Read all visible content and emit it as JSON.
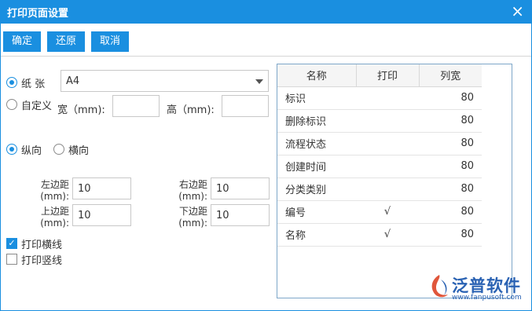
{
  "window": {
    "title": "打印页面设置",
    "close_icon": "close-icon"
  },
  "toolbar": {
    "confirm_label": "确定",
    "restore_label": "还原",
    "cancel_label": "取消"
  },
  "paper": {
    "paper_label": "纸 张",
    "paper_selected": true,
    "paper_value": "A4",
    "custom_label": "自定义",
    "custom_selected": false,
    "width_label": "宽（mm):",
    "width_value": "",
    "height_label": "高（mm):",
    "height_value": ""
  },
  "orientation": {
    "portrait_label": "纵向",
    "portrait_selected": true,
    "landscape_label": "横向",
    "landscape_selected": false
  },
  "margins": {
    "left_label_1": "左边距",
    "left_label_2": "(mm):",
    "left_value": "10",
    "right_label_1": "右边距",
    "right_label_2": "(mm):",
    "right_value": "10",
    "top_label_1": "上边距",
    "top_label_2": "(mm):",
    "top_value": "10",
    "bottom_label_1": "下边距",
    "bottom_label_2": "(mm):",
    "bottom_value": "10"
  },
  "options": {
    "h_lines_label": "打印横线",
    "h_lines_checked": true,
    "v_lines_label": "打印竖线",
    "v_lines_checked": false
  },
  "columns_table": {
    "headers": {
      "name": "名称",
      "print": "打印",
      "width": "列宽"
    },
    "rows": [
      {
        "name": "标识",
        "print": "",
        "width": "80"
      },
      {
        "name": "删除标识",
        "print": "",
        "width": "80"
      },
      {
        "name": "流程状态",
        "print": "",
        "width": "80"
      },
      {
        "name": "创建时间",
        "print": "",
        "width": "80"
      },
      {
        "name": "分类类别",
        "print": "",
        "width": "80"
      },
      {
        "name": "编号",
        "print": "√",
        "width": "80"
      },
      {
        "name": "名称",
        "print": "√",
        "width": "80"
      }
    ]
  },
  "logo": {
    "brand": "泛普软件",
    "url": "www.fanpusoft.com"
  },
  "colors": {
    "accent": "#1a8fe0",
    "logo": "#2a62b3"
  }
}
